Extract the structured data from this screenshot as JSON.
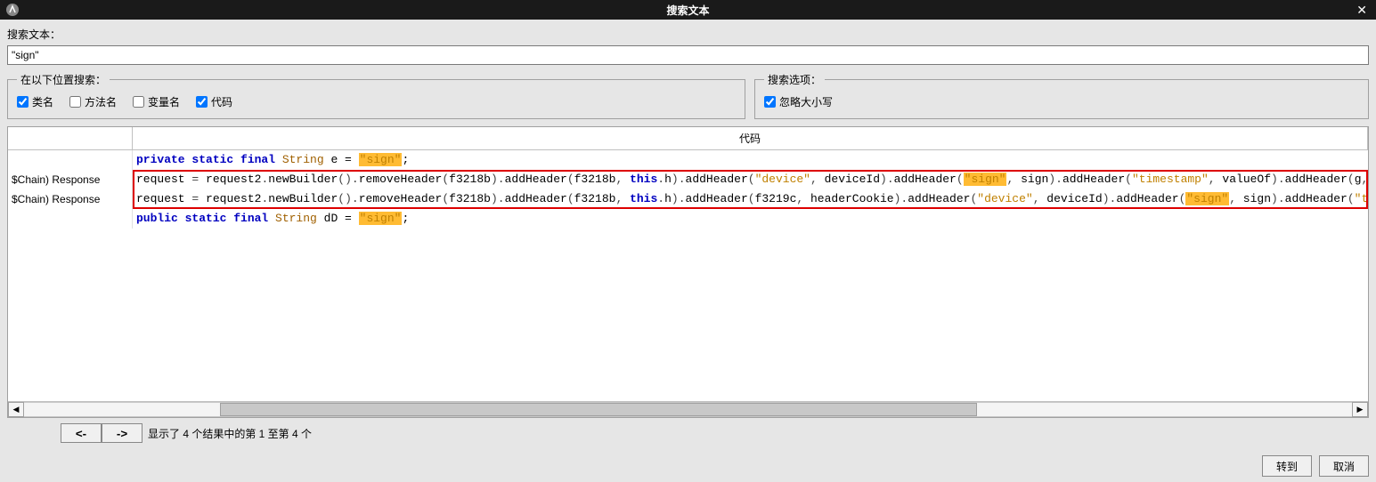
{
  "window": {
    "title": "搜索文本"
  },
  "search": {
    "label": "搜索文本：",
    "value": "\"sign\""
  },
  "scope": {
    "legend": "在以下位置搜索：",
    "class_name": {
      "label": "类名",
      "checked": true
    },
    "method_name": {
      "label": "方法名",
      "checked": false
    },
    "variable_name": {
      "label": "变量名",
      "checked": false
    },
    "code": {
      "label": "代码",
      "checked": true
    }
  },
  "options": {
    "legend": "搜索选项：",
    "ignore_case": {
      "label": "忽略大小写",
      "checked": true
    }
  },
  "table": {
    "col_a": "",
    "col_b": "代码",
    "rows_a": [
      "",
      "$Chain) Response",
      "$Chain) Response",
      ""
    ]
  },
  "code_rows": {
    "r0": {
      "pre": "private static final ",
      "type": "String",
      "mid": " e = ",
      "lit": "\"sign\"",
      "post": ";"
    },
    "r1": "request = request2.newBuilder().removeHeader(f3218b).addHeader(f3218b, this.h).addHeader(\"device\", deviceId).addHeader(\"sign\", sign).addHeader(\"timestamp\", valueOf).addHeader(g,",
    "r2": "request = request2.newBuilder().removeHeader(f3218b).addHeader(f3218b, this.h).addHeader(f3219c, headerCookie).addHeader(\"device\", deviceId).addHeader(\"sign\", sign).addHeader(\"t",
    "r3": {
      "pre": "public static final ",
      "type": "String",
      "mid": " dD = ",
      "lit": "\"sign\"",
      "post": ";"
    }
  },
  "nav": {
    "prev": "<-",
    "next": "->",
    "status": "显示了 4 个结果中的第 1 至第 4 个"
  },
  "footer": {
    "go": "转到",
    "cancel": "取消"
  }
}
